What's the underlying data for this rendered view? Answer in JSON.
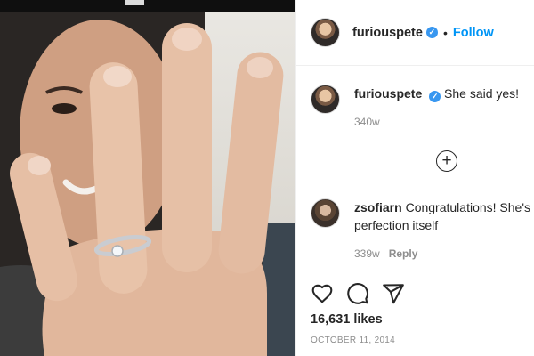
{
  "post": {
    "author": "furiouspete",
    "follow_label": "Follow",
    "separator": "•",
    "caption": {
      "user": "furiouspete",
      "text": "She said yes!",
      "age": "340w"
    },
    "comments": [
      {
        "user": "zsofiarn",
        "text": "Congratulations! She's perfection itself",
        "age": "339w",
        "reply_label": "Reply"
      }
    ],
    "likes": "16,631 likes",
    "date": "October 11, 2014",
    "load_more_icon": "plus-circle-icon",
    "action_icons": [
      "heart-icon",
      "comment-icon",
      "share-icon"
    ],
    "colors": {
      "link_blue": "#0095f6",
      "verified_blue": "#3897f0",
      "muted_text": "#8e8e8e",
      "divider": "#efefef"
    }
  }
}
